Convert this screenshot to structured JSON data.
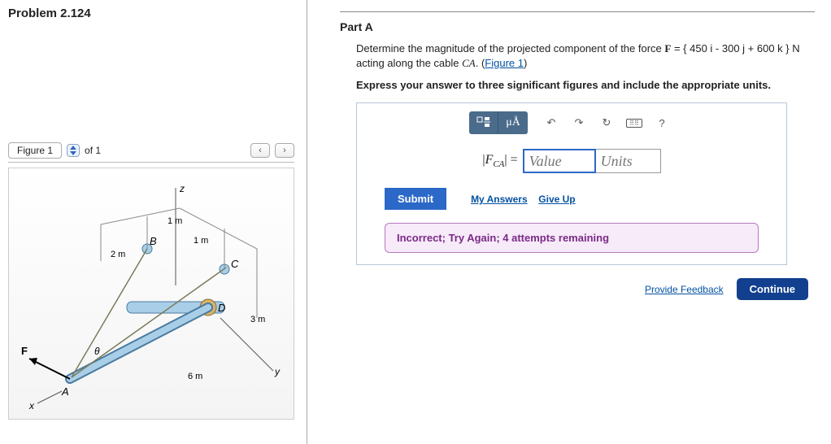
{
  "problem_title": "Problem 2.124",
  "figure_panel": {
    "tab_label": "Figure 1",
    "page_of": "of 1",
    "nav_prev": "‹",
    "nav_next": "›"
  },
  "figure": {
    "labels": {
      "z": "z",
      "y": "y",
      "x": "x",
      "A": "A",
      "B": "B",
      "C": "C",
      "D": "D",
      "F": "F",
      "theta": "θ"
    },
    "dims": {
      "d1": "1 m",
      "d1b": "1 m",
      "d2": "2 m",
      "d3": "3 m",
      "d6": "6 m"
    }
  },
  "part": {
    "title": "Part A",
    "desc_1": "Determine the magnitude of the projected component of the force ",
    "force_prefix": "F",
    "force_expr": " = { 450 i - 300 j + 600 k } N",
    "desc_2": " acting along the cable ",
    "cable": "CA",
    "desc_3": ". (",
    "figure_link": "Figure 1",
    "desc_4": ")",
    "instruction": "Express your answer to three significant figures and include the appropriate units."
  },
  "toolbar": {
    "template": "▭",
    "units": "μÅ",
    "undo": "↶",
    "redo": "↷",
    "reset": "↻",
    "keyboard": "⌨",
    "help": "?"
  },
  "answer": {
    "lhs_prefix": "|",
    "lhs_var": "F",
    "lhs_sub": "CA",
    "lhs_suffix": "| =",
    "value_placeholder": "Value",
    "units_placeholder": "Units"
  },
  "actions": {
    "submit": "Submit",
    "my_answers": "My Answers",
    "give_up": "Give Up"
  },
  "feedback_msg": "Incorrect; Try Again; 4 attempts remaining",
  "footer": {
    "provide_feedback": "Provide Feedback",
    "continue": "Continue"
  }
}
